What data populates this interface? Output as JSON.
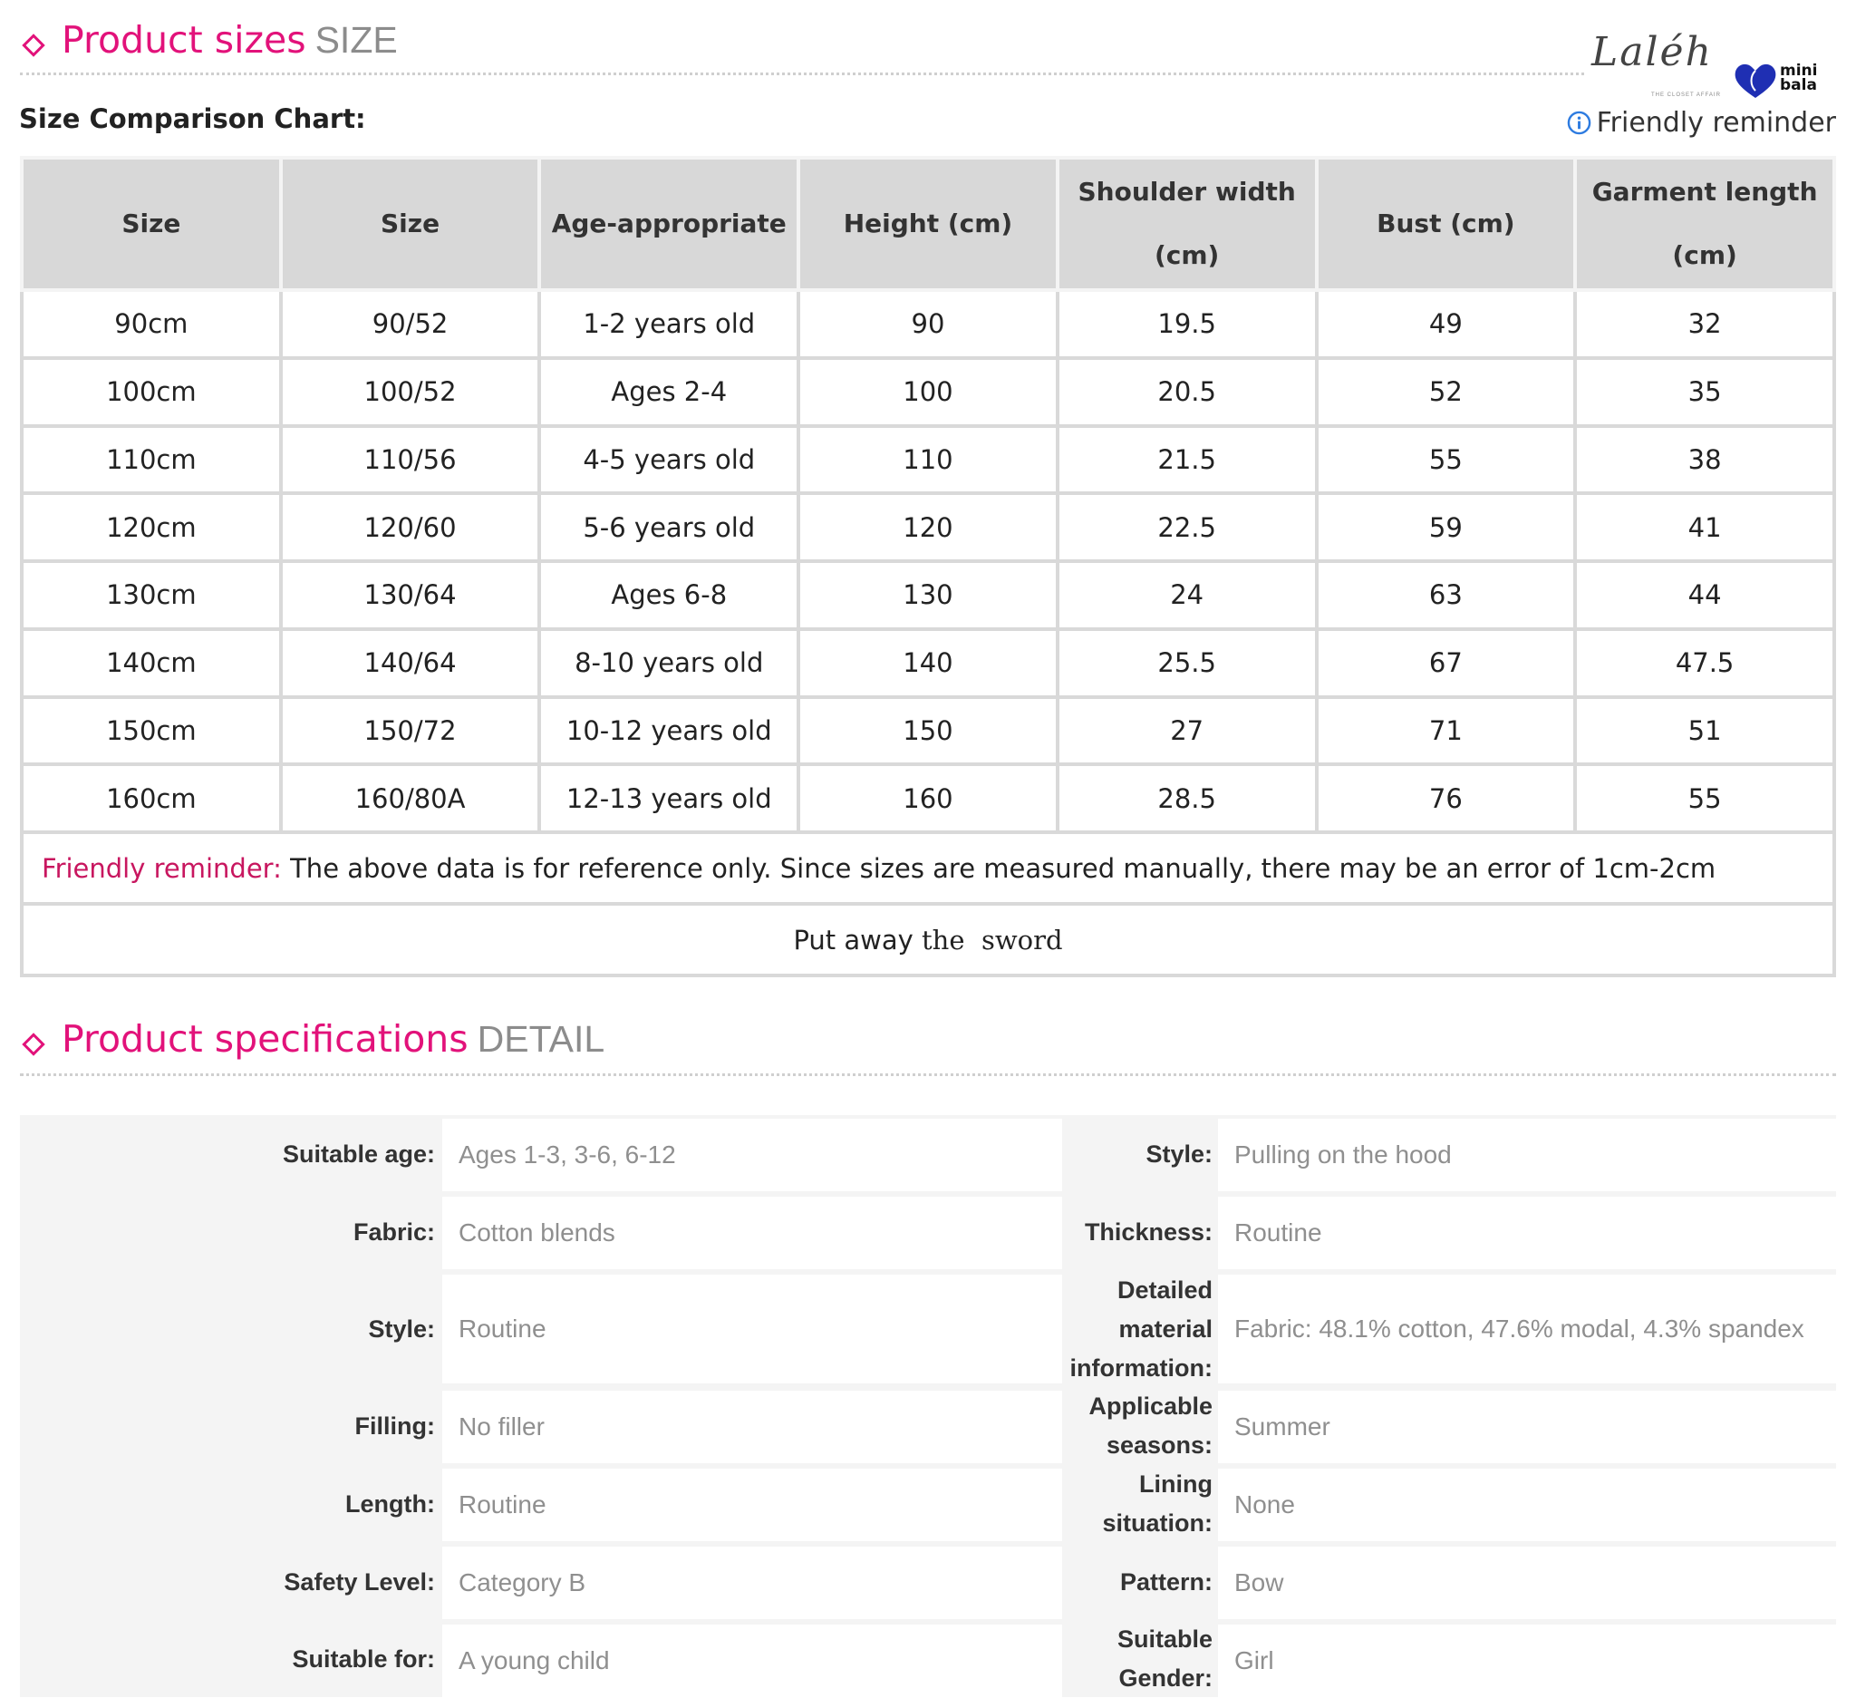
{
  "sizes_section": {
    "title": "Product sizes",
    "subtitle": "SIZE",
    "chart_label": "Size Comparison Chart:",
    "reminder_link": "Friendly reminder",
    "brand_script": "Laléh",
    "brand_sub": "THE CLOSET AFFAIR",
    "brand_mini_1": "mini",
    "brand_mini_2": "bala"
  },
  "size_table": {
    "headers": [
      [
        "Size"
      ],
      [
        "Size"
      ],
      [
        "Age-appropriate"
      ],
      [
        "Height (cm)"
      ],
      [
        "Shoulder width",
        "(cm)"
      ],
      [
        "Bust (cm)"
      ],
      [
        "Garment length",
        "(cm)"
      ]
    ],
    "rows": [
      [
        "90cm",
        "90/52",
        "1-2 years old",
        "90",
        "19.5",
        "49",
        "32"
      ],
      [
        "100cm",
        "100/52",
        "Ages 2-4",
        "100",
        "20.5",
        "52",
        "35"
      ],
      [
        "110cm",
        "110/56",
        "4-5 years old",
        "110",
        "21.5",
        "55",
        "38"
      ],
      [
        "120cm",
        "120/60",
        "5-6 years old",
        "120",
        "22.5",
        "59",
        "41"
      ],
      [
        "130cm",
        "130/64",
        "Ages 6-8",
        "130",
        "24",
        "63",
        "44"
      ],
      [
        "140cm",
        "140/64",
        "8-10 years old",
        "140",
        "25.5",
        "67",
        "47.5"
      ],
      [
        "150cm",
        "150/72",
        "10-12 years old",
        "150",
        "27",
        "71",
        "51"
      ],
      [
        "160cm",
        "160/80A",
        "12-13 years old",
        "160",
        "28.5",
        "76",
        "55"
      ]
    ],
    "note_key": "Friendly reminder:",
    "note_text": " The above data is for reference only. Since sizes are measured manually, there may be an error of 1cm-2cm",
    "footer_a": "Put away",
    "footer_b": "the  sword"
  },
  "spec_section": {
    "title": "Product specifications",
    "subtitle": "DETAIL"
  },
  "specs": {
    "left": [
      {
        "label": "Suitable age:",
        "value": "Ages 1-3, 3-6, 6-12"
      },
      {
        "label": "Fabric:",
        "value": "Cotton blends"
      },
      {
        "label": "Style:",
        "value": "Routine"
      },
      {
        "label": "Filling:",
        "value": "No filler"
      },
      {
        "label": "Length:",
        "value": "Routine"
      },
      {
        "label": "Safety Level:",
        "value": "Category B"
      },
      {
        "label": "Suitable for:",
        "value": "A young child"
      }
    ],
    "right": [
      {
        "label": "Style:",
        "value": "Pulling on the hood"
      },
      {
        "label": "Thickness:",
        "value": "Routine"
      },
      {
        "label": "Detailed material information:",
        "value": "Fabric: 48.1% cotton, 47.6% modal, 4.3% spandex"
      },
      {
        "label": "Applicable seasons:",
        "value": "Summer"
      },
      {
        "label": "Lining situation:",
        "value": "None"
      },
      {
        "label": "Pattern:",
        "value": "Bow"
      },
      {
        "label": "Suitable Gender:",
        "value": "Girl"
      }
    ]
  },
  "colors": {
    "accent": "#e2127a",
    "header_bg": "#d8d8d8",
    "spec_bg": "#f4f4f4",
    "brand_blue": "#1f2fb3"
  }
}
